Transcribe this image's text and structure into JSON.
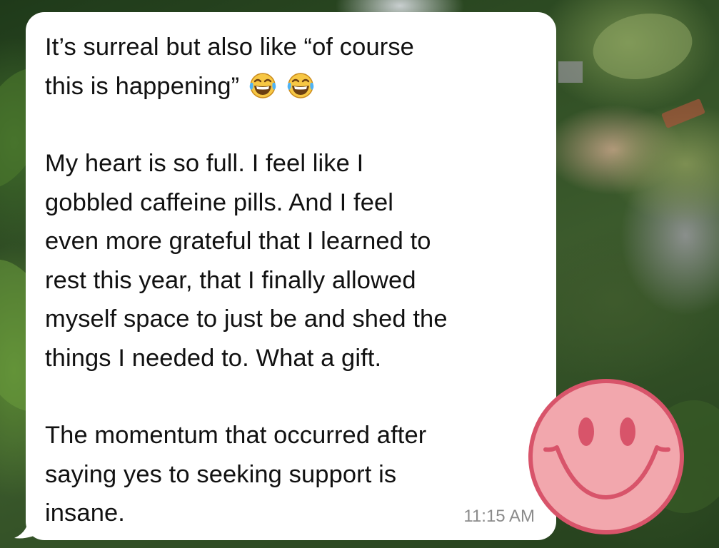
{
  "message": {
    "paragraph1": {
      "line1": "It’s surreal but also like “of course",
      "line2": "this is happening”",
      "emojis": [
        "face-with-tears-of-joy-icon",
        "face-with-tears-of-joy-icon"
      ]
    },
    "paragraph2": [
      "My heart is so full. I feel like I",
      "gobbled caffeine pills. And I feel",
      "even more grateful that I learned to",
      "rest this year, that I finally allowed",
      "myself space to just be and shed the",
      "things I needed to. What a gift."
    ],
    "paragraph3": [
      "The momentum that occurred after",
      "saying yes to seeking support is",
      "insane."
    ],
    "timestamp": "11:15 AM"
  },
  "sticker": {
    "icon": "smiley-face-sticker-icon",
    "fill": "#f2a7ad",
    "stroke": "#d8546a"
  },
  "colors": {
    "bubble": "#ffffff",
    "text": "#111111",
    "timestamp": "#8b8b8b"
  }
}
